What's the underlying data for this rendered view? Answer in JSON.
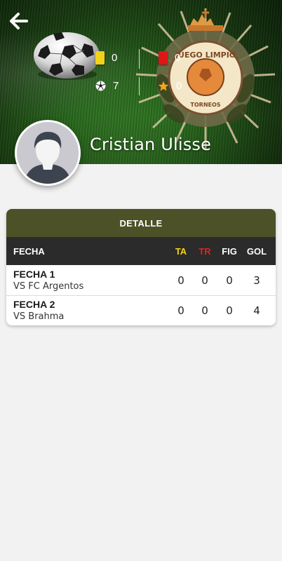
{
  "header": {
    "player_name": "Cristian Ulisse",
    "stats": {
      "yellow_cards": "0",
      "red_cards": "0",
      "goals": "7",
      "figure": "0"
    },
    "crest_text_top": "JUEGO LIMPIO",
    "crest_text_bottom": "TORNEOS"
  },
  "table": {
    "title": "DETALLE",
    "columns": {
      "fecha": "FECHA",
      "ta": "TA",
      "tr": "TR",
      "fig": "FIG",
      "gol": "GOL"
    },
    "rows": [
      {
        "date": "FECHA 1",
        "opponent": "VS FC Argentos",
        "ta": "0",
        "tr": "0",
        "fig": "0",
        "gol": "3"
      },
      {
        "date": "FECHA 2",
        "opponent": "VS Brahma",
        "ta": "0",
        "tr": "0",
        "fig": "0",
        "gol": "4"
      }
    ]
  },
  "colors": {
    "title_bar": "#4c5128",
    "table_header": "#2b2b2b",
    "ta_header": "#f4d40f",
    "tr_header": "#e0231d",
    "yellow_card": "#f2d21a",
    "red_card": "#e01616"
  }
}
